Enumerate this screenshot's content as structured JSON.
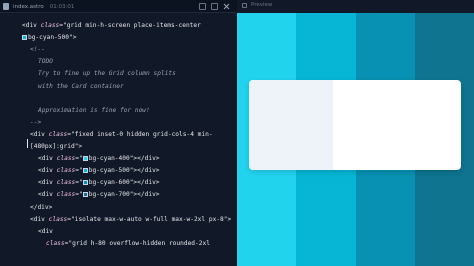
{
  "editor": {
    "tab_title": "index.astro",
    "tab_time": "01:03:01",
    "lines": [
      [
        {
          "t": "<div ",
          "k": "punc"
        },
        {
          "t": "class",
          "k": "attr"
        },
        {
          "t": "=\"grid min-h-screen place-items-center",
          "k": "str"
        }
      ],
      [
        {
          "swatch": "#06b6d4"
        },
        {
          "t": "bg-cyan-500\">",
          "k": "str"
        }
      ],
      [
        {
          "t": "<!--",
          "k": "c"
        }
      ],
      [
        {
          "t": "TODO",
          "k": "c"
        }
      ],
      [
        {
          "t": "Try to fine up the Grid column splits",
          "k": "c"
        }
      ],
      [
        {
          "t": "with the Card container",
          "k": "c"
        }
      ],
      [
        {
          "t": "",
          "k": "c"
        }
      ],
      [
        {
          "t": "Approximation is fine for now!",
          "k": "c"
        }
      ],
      [
        {
          "t": "-->",
          "k": "c"
        }
      ],
      [
        {
          "t": "<div ",
          "k": "punc"
        },
        {
          "t": "class",
          "k": "attr"
        },
        {
          "t": "=\"fixed inset-0 hidden grid-cols-4 min-",
          "k": "str"
        }
      ],
      [
        {
          "t": "[480px]:grid\">",
          "k": "str"
        }
      ],
      [
        {
          "t": "<div ",
          "k": "punc"
        },
        {
          "t": "class",
          "k": "attr"
        },
        {
          "t": "=\"",
          "k": "str"
        },
        {
          "swatch": "#22d3ee"
        },
        {
          "t": "bg-cyan-400\"></div>",
          "k": "str"
        }
      ],
      [
        {
          "t": "<div ",
          "k": "punc"
        },
        {
          "t": "class",
          "k": "attr"
        },
        {
          "t": "=\"",
          "k": "str"
        },
        {
          "swatch": "#06b6d4"
        },
        {
          "t": "bg-cyan-500\"></div>",
          "k": "str"
        }
      ],
      [
        {
          "t": "<div ",
          "k": "punc"
        },
        {
          "t": "class",
          "k": "attr"
        },
        {
          "t": "=\"",
          "k": "str"
        },
        {
          "swatch": "#0891b2"
        },
        {
          "t": "bg-cyan-600\"></div>",
          "k": "str"
        }
      ],
      [
        {
          "t": "<div ",
          "k": "punc"
        },
        {
          "t": "class",
          "k": "attr"
        },
        {
          "t": "=\"",
          "k": "str"
        },
        {
          "swatch": "#0e7490"
        },
        {
          "t": "bg-cyan-700\"></div>",
          "k": "str"
        }
      ],
      [
        {
          "t": "</div>",
          "k": "punc"
        }
      ],
      [
        {
          "t": "<div ",
          "k": "punc"
        },
        {
          "t": "class",
          "k": "attr"
        },
        {
          "t": "=\"isolate max-w-auto w-full max-w-2xl px-8\">",
          "k": "str"
        }
      ],
      [
        {
          "t": "<div",
          "k": "punc"
        }
      ],
      [
        {
          "t": "class",
          "k": "attr"
        },
        {
          "t": "=\"grid h-80 overflow-hidden rounded-2xl",
          "k": "str"
        }
      ]
    ]
  },
  "preview": {
    "label": "Preview",
    "columns": [
      "#22d3ee",
      "#06b6d4",
      "#0891b2",
      "#0e7490"
    ]
  }
}
